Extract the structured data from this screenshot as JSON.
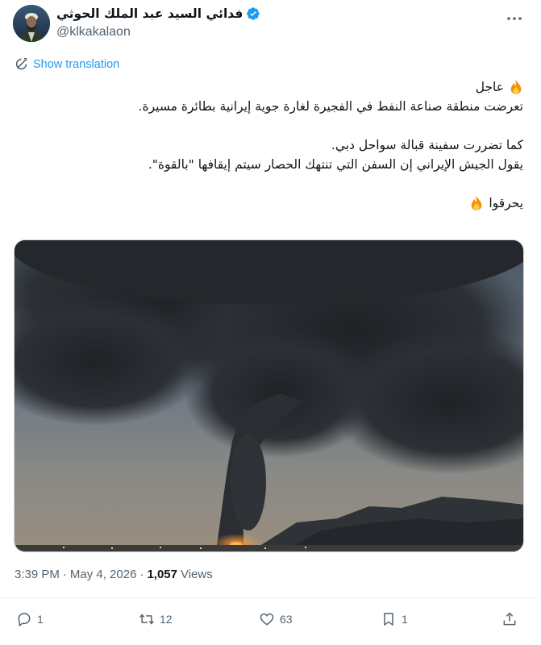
{
  "author": {
    "display_name": "فدائي السيد عبد الملك الحوثي",
    "handle": "@klkakalaon",
    "verified": true
  },
  "translate_label": "Show translation",
  "tweet_lines": {
    "line1": "عاجل",
    "line2": "تعرضت منطقة صناعة النفط في الفجيرة لغارة جوية إيرانية بطائرة مسيرة.",
    "line3": "كما تضررت سفينة قبالة سواحل دبي.",
    "line4": "يقول الجيش الإيراني إن السفن التي تنتهك الحصار سيتم إيقافها \"بالقوة\".",
    "line5": "يحرقوا"
  },
  "meta": {
    "time": "3:39 PM",
    "separator": "·",
    "date": "May 4, 2026",
    "views_count": "1,057",
    "views_label": "Views"
  },
  "actions": {
    "replies": "1",
    "reposts": "12",
    "likes": "63",
    "bookmarks": "1"
  },
  "icons": {
    "more": "more-icon",
    "translate": "translate-icon",
    "reply": "reply-icon",
    "repost": "repost-icon",
    "like": "heart-icon",
    "bookmark": "bookmark-icon",
    "share": "share-icon",
    "fire": "fire-emoji-icon",
    "verified": "verified-badge-icon"
  },
  "colors": {
    "accent": "#1d9bf0",
    "secondary_text": "#536471",
    "primary_text": "#0f1419"
  }
}
